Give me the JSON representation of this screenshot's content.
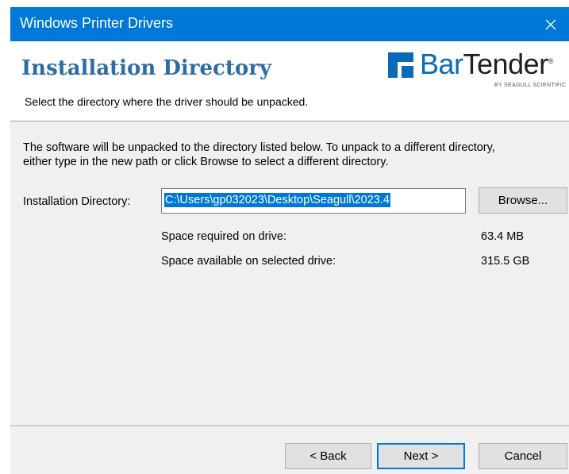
{
  "window": {
    "title": "Windows Printer Drivers",
    "close_glyph": "✕"
  },
  "header": {
    "title": "Installation Directory",
    "subtitle": "Select the directory where the driver should be unpacked.",
    "logo": {
      "word_a": "Bar",
      "word_b": "Tender",
      "registered": "®",
      "tagline": "BY SEAGULL SCIENTIFIC"
    }
  },
  "body": {
    "description_line1": "The software will be unpacked to the directory listed below.  To unpack to a different directory,",
    "description_line2": "either type in the new path or click Browse to select a different directory.",
    "directory_label": "Installation Directory:",
    "directory_value": "C:\\Users\\gp032023\\Desktop\\Seagull\\2023.4",
    "browse_label": "Browse...",
    "space_required_label": "Space required on drive:",
    "space_required_value": "63.4 MB",
    "space_available_label": "Space available on selected drive:",
    "space_available_value": "315.5 GB"
  },
  "footer": {
    "back_label": "< Back",
    "next_label": "Next >",
    "cancel_label": "Cancel"
  },
  "colors": {
    "titlebar": "#0078d7",
    "heading": "#2e6da4",
    "logo_accent": "#0a6ab8",
    "selection": "#0078d7"
  }
}
